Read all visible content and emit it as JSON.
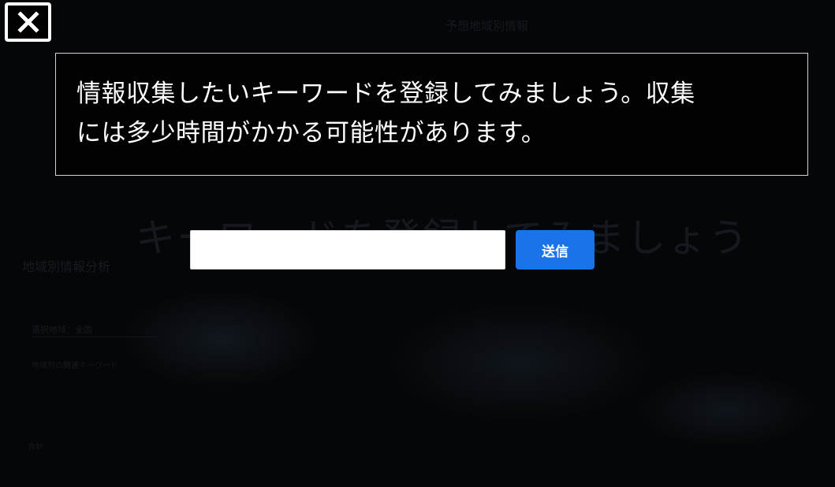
{
  "background": {
    "title": "予想地域別情報",
    "heading": "キーワードを登録してみましょう",
    "side_title": "地域別情報分析",
    "side_field": "選択地域：全国",
    "side_text": "地域別の関連キーワード",
    "footer": "合計"
  },
  "close": {
    "icon": "close-icon"
  },
  "message": {
    "line1": "情報収集したいキーワードを登録してみましょう。収集",
    "line2": "には多少時間がかかる可能性があります。"
  },
  "form": {
    "input_value": "",
    "input_placeholder": "",
    "submit_label": "送信"
  },
  "colors": {
    "overlay": "#050608",
    "accent": "#1a73e8",
    "border": "#cfd3d8",
    "text": "#ffffff"
  }
}
